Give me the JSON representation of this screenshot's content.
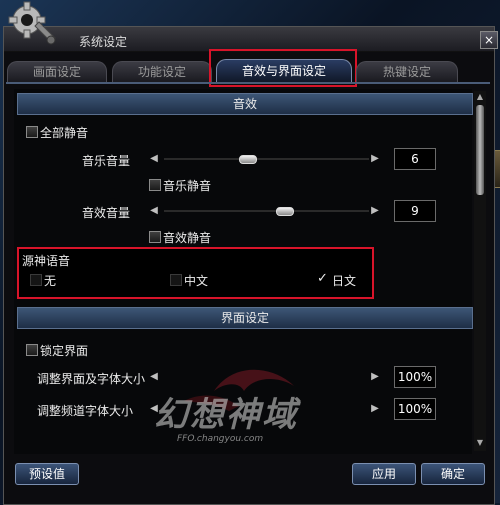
{
  "window": {
    "title": "系统设定",
    "close_glyph": "×"
  },
  "tabs": [
    {
      "label": "画面设定",
      "active": false
    },
    {
      "label": "功能设定",
      "active": false
    },
    {
      "label": "音效与界面设定",
      "active": true
    },
    {
      "label": "热键设定",
      "active": false
    }
  ],
  "sound": {
    "header": "音效",
    "mute_all_label": "全部静音",
    "music_volume_label": "音乐音量",
    "music_volume_value": "6",
    "music_volume_level": 0.4,
    "music_mute_label": "音乐静音",
    "effect_volume_label": "音效音量",
    "effect_volume_value": "9",
    "effect_volume_level": 0.6,
    "effect_mute_label": "音效静音"
  },
  "voice": {
    "title": "源神语音",
    "options": [
      {
        "label": "无",
        "selected": false
      },
      {
        "label": "中文",
        "selected": false
      },
      {
        "label": "日文",
        "selected": true
      }
    ]
  },
  "interface": {
    "header": "界面设定",
    "lock_label": "锁定界面",
    "ui_font_size_label": "调整界面及字体大小",
    "ui_font_size_value": "100%",
    "channel_font_size_label": "调整频道字体大小",
    "channel_font_size_value": "100%"
  },
  "watermark": {
    "logo_text": "幻想神域",
    "url": "FFO.changyou.com"
  },
  "buttons": {
    "default": "预设值",
    "apply": "应用",
    "confirm": "确定"
  },
  "icons": {
    "arrow_left": "◀",
    "arrow_right": "▶",
    "check": "✓",
    "scroll_up": "▲",
    "scroll_down": "▼"
  },
  "colors": {
    "highlight_red": "#d8142a",
    "header_blue": "#3d5676"
  }
}
